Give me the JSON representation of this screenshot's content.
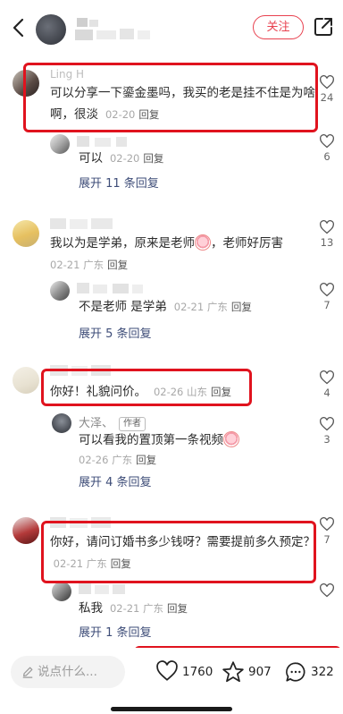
{
  "header": {
    "follow_label": "关注"
  },
  "comments": [
    {
      "name": "Ling H",
      "text": "可以分享一下鎏金墨吗，我买的老是挂不住是为啥啊，很淡",
      "date": "02-20",
      "reply": "回复",
      "likes": "24",
      "subreply": {
        "text": "可以",
        "date": "02-20",
        "reply": "回复",
        "likes": "6"
      },
      "expand": "展开 11 条回复"
    },
    {
      "text": "我以为是学弟，原来是老师",
      "text2": "，老师好厉害",
      "date": "02-21",
      "location": "广东",
      "reply": "回复",
      "likes": "13",
      "subreply": {
        "text": "不是老师 是学弟",
        "date": "02-21",
        "location": "广东",
        "reply": "回复",
        "likes": "7"
      },
      "expand": "展开 5 条回复"
    },
    {
      "text": "你好！礼貌问价。",
      "date": "02-26",
      "location": "山东",
      "reply": "回复",
      "likes": "4",
      "subreply": {
        "name": "大泽、",
        "tag": "作者",
        "text": "可以看我的置顶第一条视频",
        "date": "02-26",
        "location": "广东",
        "reply": "回复",
        "likes": "3"
      },
      "expand": "展开 4 条回复"
    },
    {
      "text": "你好，请问订婚书多少钱呀？需要提前多久预定？",
      "date": "02-21",
      "location": "广东",
      "reply": "回复",
      "likes": "7",
      "subreply": {
        "text": "私我",
        "date": "02-21",
        "location": "广东",
        "reply": "回复"
      },
      "expand": "展开 1 条回复"
    }
  ],
  "bottom": {
    "input_placeholder": "说点什么...",
    "likes": "1760",
    "stars": "907",
    "comments": "322"
  }
}
